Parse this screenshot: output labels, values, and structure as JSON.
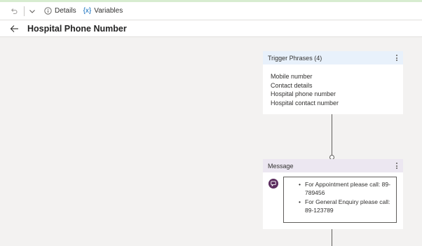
{
  "toolbar": {
    "details_label": "Details",
    "variables_icon_text": "{x}",
    "variables_label": "Variables"
  },
  "header": {
    "title": "Hospital Phone Number"
  },
  "trigger_node": {
    "title": "Trigger Phrases (4)",
    "phrases": [
      "Mobile number",
      "Contact details",
      "Hospital phone number",
      "Hospital contact number"
    ]
  },
  "message_node": {
    "title": "Message",
    "bullets": [
      [
        "For Appointment please call: 89-",
        "789456"
      ],
      [
        "For General Enquiry please call:",
        "89-123789"
      ]
    ]
  },
  "colors": {
    "accent": "#0f6cbd",
    "trigger_header": "#e8f1fb",
    "message_header": "#ece7f1",
    "bot_icon": "#5c2e5f"
  }
}
